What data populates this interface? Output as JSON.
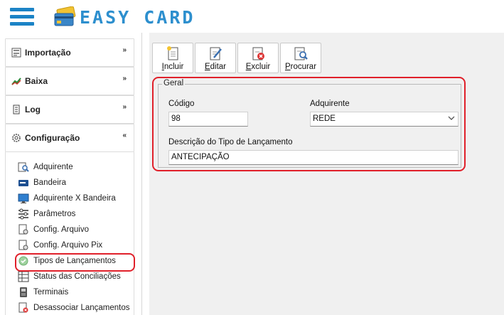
{
  "app": {
    "logo_text": "EASY CARD"
  },
  "sidebar": {
    "sections": [
      {
        "label": "Importação",
        "icon": "import-icon",
        "chevron": "»"
      },
      {
        "label": "Baixa",
        "icon": "chart-icon",
        "chevron": "»"
      },
      {
        "label": "Log",
        "icon": "log-icon",
        "chevron": "»"
      },
      {
        "label": "Configuração",
        "icon": "gear-icon",
        "chevron": "«"
      }
    ],
    "config_items": [
      {
        "label": "Adquirente",
        "icon": "search-doc-icon"
      },
      {
        "label": "Bandeira",
        "icon": "card-icon"
      },
      {
        "label": "Adquirente X Bandeira",
        "icon": "monitor-icon"
      },
      {
        "label": "Parâmetros",
        "icon": "sliders-icon"
      },
      {
        "label": "Config. Arquivo",
        "icon": "file-gear-icon"
      },
      {
        "label": "Config. Arquivo Pix",
        "icon": "file-gear-icon"
      },
      {
        "label": "Tipos de Lançamentos",
        "icon": "check-circle-icon",
        "active": true
      },
      {
        "label": "Status das Conciliações",
        "icon": "grid-icon"
      },
      {
        "label": "Terminais",
        "icon": "terminal-icon"
      },
      {
        "label": "Desassociar Lançamentos",
        "icon": "file-x-icon"
      }
    ]
  },
  "toolbar": {
    "buttons": [
      {
        "label": "Incluir",
        "underline": "I",
        "rest": "ncluir",
        "icon": "new-doc-icon"
      },
      {
        "label": "Editar",
        "underline": "E",
        "rest": "ditar",
        "icon": "edit-doc-icon"
      },
      {
        "label": "Excluir",
        "underline": "E",
        "rest": "xcluir",
        "icon": "delete-doc-icon"
      },
      {
        "label": "Procurar",
        "underline": "P",
        "rest": "rocurar",
        "icon": "search-doc-icon"
      }
    ]
  },
  "form": {
    "legend": "Geral",
    "codigo_label": "Código",
    "codigo_value": "98",
    "adquirente_label": "Adquirente",
    "adquirente_value": "REDE",
    "descricao_label": "Descrição do Tipo de Lançamento",
    "descricao_value": "ANTECIPAÇÃO"
  },
  "colors": {
    "accent": "#1b83c6",
    "highlight": "#e0202a",
    "main_bg": "#f0f0f0"
  }
}
